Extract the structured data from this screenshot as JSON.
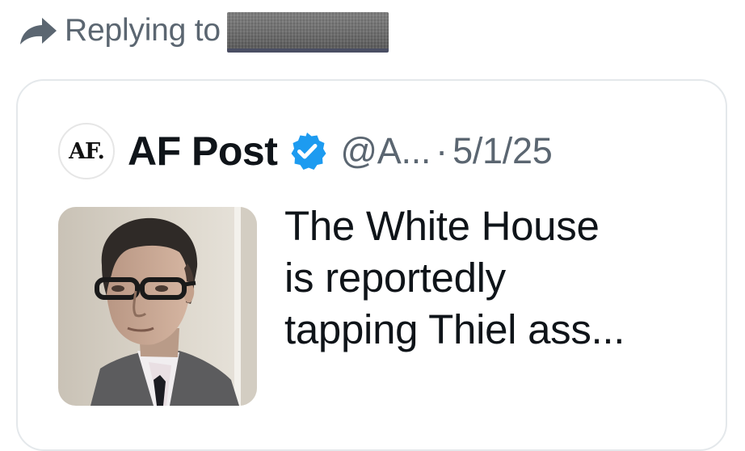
{
  "reply_bar": {
    "icon": "reply-arrow-icon",
    "label": "Replying to"
  },
  "quoted_post": {
    "source_logo_text": "AF.",
    "author_name": "AF Post",
    "verified_icon": "verified-badge-icon",
    "verified_color": "#1d9bf0",
    "handle": "@A...",
    "separator": "·",
    "date": "5/1/25",
    "text_lines": [
      "The White House",
      "is reportedly",
      "tapping Thiel ass..."
    ],
    "media": "photo of a man with glasses"
  },
  "colors": {
    "secondary_text": "#5b6671",
    "primary_text": "#0f1419",
    "border": "#e4e8eb"
  }
}
